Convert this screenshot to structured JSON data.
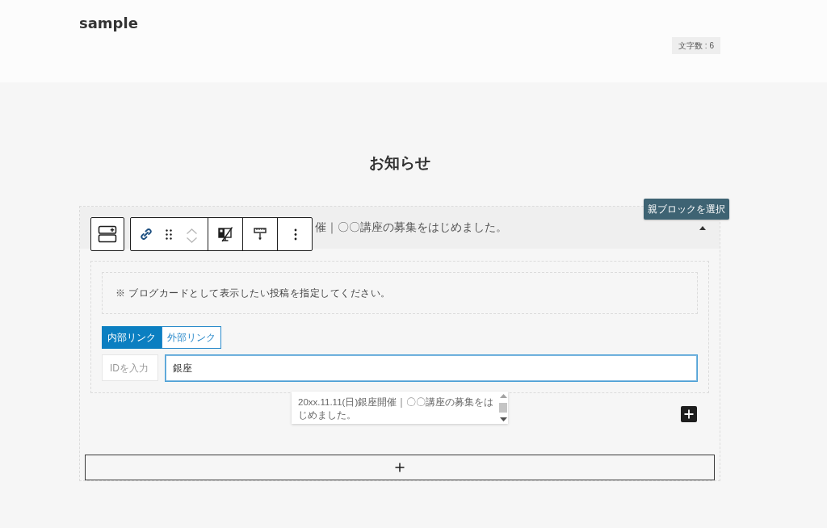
{
  "header": {
    "title": "sample",
    "character_count": "文字数 : 6"
  },
  "section": {
    "heading": "お知らせ"
  },
  "tooltip": {
    "text": "親ブロックを選択"
  },
  "accordion": {
    "title": "催｜〇〇講座の募集をはじめました。",
    "expanded": true
  },
  "blog_card": {
    "notice": "※ ブログカードとして表示したい投稿を指定してください。",
    "tabs": [
      {
        "label": "内部リンク",
        "selected": true
      },
      {
        "label": "外部リンク",
        "selected": false
      }
    ],
    "id_field": {
      "placeholder": "IDを入力"
    },
    "search_field": {
      "value": "銀座"
    },
    "suggestions": [
      {
        "text": "20xx.11.11(日)銀座開催｜〇〇講座の募集をはじめました。"
      }
    ]
  }
}
